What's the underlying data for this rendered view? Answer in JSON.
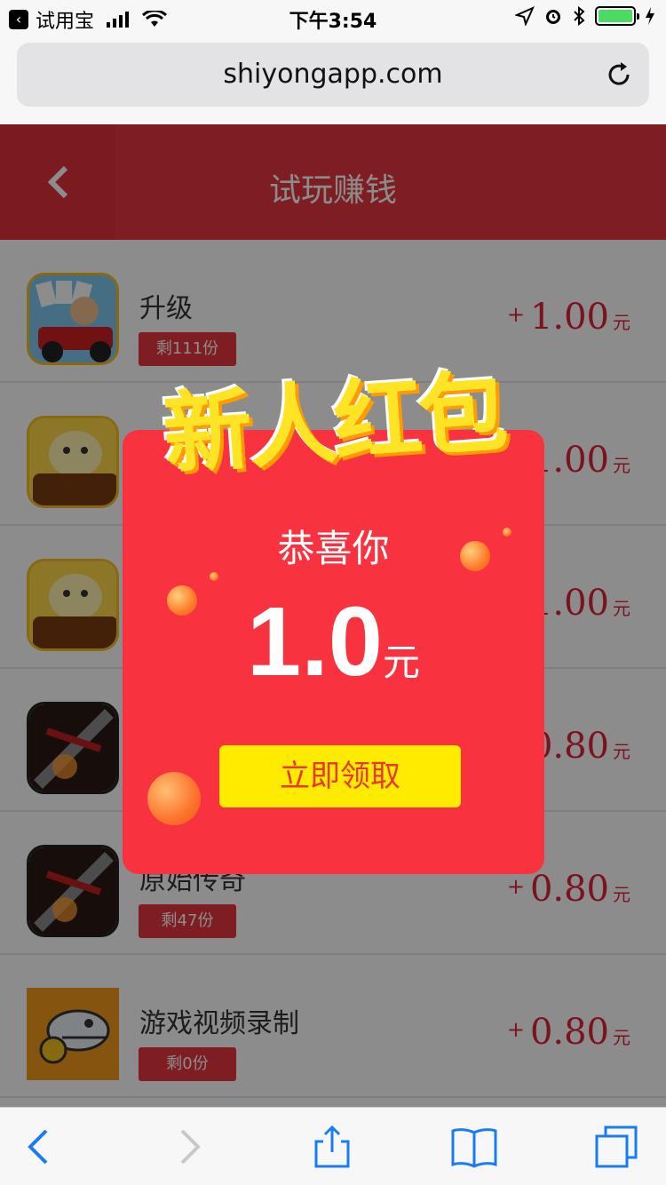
{
  "status_bar": {
    "app_name": "试用宝",
    "time": "下午3:54"
  },
  "browser": {
    "url": "shiyongapp.com"
  },
  "header": {
    "title": "试玩赚钱"
  },
  "list": {
    "items": [
      {
        "name": "升级",
        "remain": "剩111份",
        "plus": "+",
        "amount": "1.00",
        "unit": "元"
      },
      {
        "name": "",
        "remain": "",
        "plus": "",
        "amount": "1.00",
        "unit": "元"
      },
      {
        "name": "",
        "remain": "",
        "plus": "",
        "amount": "1.00",
        "unit": "元"
      },
      {
        "name": "",
        "remain": "",
        "plus": "",
        "amount": "0.80",
        "unit": "元"
      },
      {
        "name": "原始传奇",
        "remain": "剩47份",
        "plus": "+",
        "amount": "0.80",
        "unit": "元"
      },
      {
        "name": "游戏视频录制",
        "remain": "剩0份",
        "plus": "+",
        "amount": "0.80",
        "unit": "元"
      }
    ]
  },
  "modal": {
    "title": "新人红包",
    "congrats": "恭喜你",
    "amount": "1.0",
    "unit": "元",
    "claim_label": "立即领取"
  },
  "colors": {
    "accent_red": "#e8373f",
    "modal_red": "#f8323e",
    "button_yellow": "#ffeb00"
  }
}
